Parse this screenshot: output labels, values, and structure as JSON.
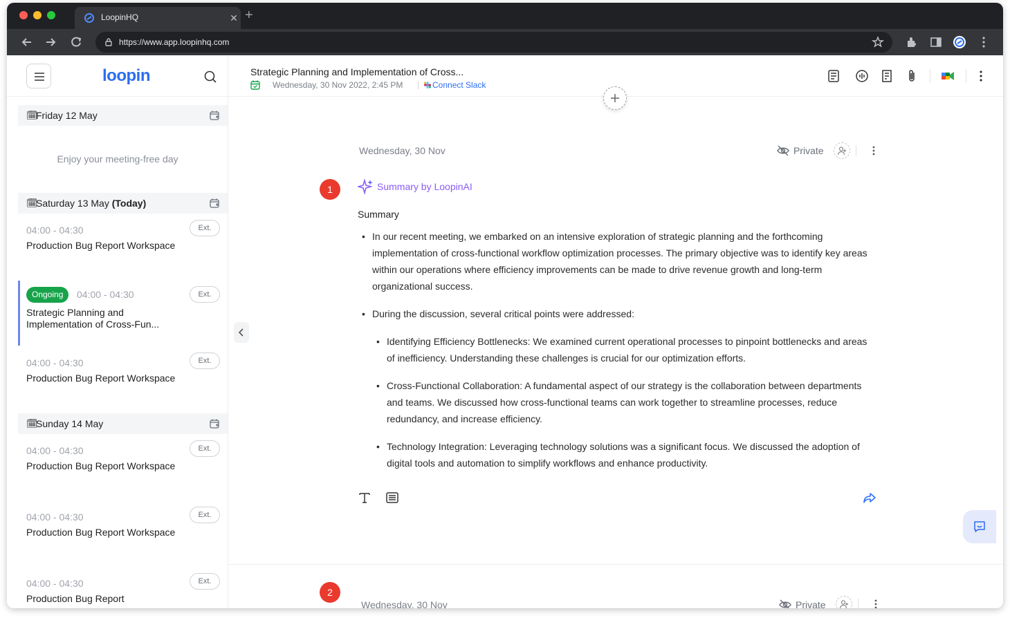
{
  "browser": {
    "tab_title": "LoopinHQ",
    "url": "https://www.app.loopinhq.com"
  },
  "sidebar": {
    "logo": "loopin",
    "days": [
      {
        "emoji": "🗓",
        "label": "Friday 12 May",
        "today_suffix": "",
        "empty_message": "Enjoy your meeting-free day"
      },
      {
        "emoji": "🗓",
        "label": "Saturday 13 May",
        "today_suffix": "(Today)",
        "meetings": [
          {
            "time": "04:00 - 04:30",
            "title": "Production Bug Report Workspace",
            "ext": "Ext."
          },
          {
            "status": "Ongoing",
            "time": "04:00 - 04:30",
            "title": "Strategic Planning and Implementation of Cross-Fun...",
            "ext": "Ext."
          },
          {
            "time": "04:00 - 04:30",
            "title": "Production Bug Report Workspace",
            "ext": "Ext."
          }
        ]
      },
      {
        "emoji": "🗓",
        "label": "Sunday 14 May",
        "today_suffix": "",
        "meetings": [
          {
            "time": "04:00 - 04:30",
            "title": "Production Bug Report Workspace",
            "ext": "Ext."
          },
          {
            "time": "04:00 - 04:30",
            "title": "Production Bug Report Workspace",
            "ext": "Ext."
          },
          {
            "time": "04:00 - 04:30",
            "title": "Production Bug Report",
            "ext": "Ext."
          }
        ]
      }
    ]
  },
  "meeting_header": {
    "title": "Strategic Planning and Implementation of Cross...",
    "datetime": "Wednesday, 30 Nov 2022, 2:45 PM",
    "connect_label": "Connect Slack"
  },
  "notes": [
    {
      "badge": "1",
      "date": "Wednesday, 30 Nov",
      "privacy": "Private",
      "ai_label": "Summary by LoopinAI",
      "heading": "Summary",
      "bullets": [
        "In our recent meeting, we embarked on an intensive exploration of strategic planning and the forthcoming implementation of cross-functional workflow optimization processes. The primary objective was to identify key areas within our operations where efficiency improvements can be made to drive revenue growth and long-term organizational success.",
        "During the discussion, several critical points were addressed:"
      ],
      "sub_bullets": [
        "Identifying Efficiency Bottlenecks: We examined current operational processes to pinpoint bottlenecks and areas of inefficiency. Understanding these challenges is crucial for our optimization efforts.",
        "Cross-Functional Collaboration: A fundamental aspect of our strategy is the collaboration between departments and teams. We discussed how cross-functional teams can work together to streamline processes, reduce redundancy, and increase efficiency.",
        "Technology Integration: Leveraging technology solutions was a significant focus. We discussed the adoption of digital tools and automation to simplify workflows and enhance productivity."
      ]
    },
    {
      "badge": "2",
      "date": "Wednesday, 30 Nov",
      "privacy": "Private"
    }
  ],
  "colors": {
    "brand": "#2b6df2",
    "ai_purple": "#8b5cf6",
    "ongoing_green": "#17a34a",
    "badge_red": "#ea3a2e"
  }
}
